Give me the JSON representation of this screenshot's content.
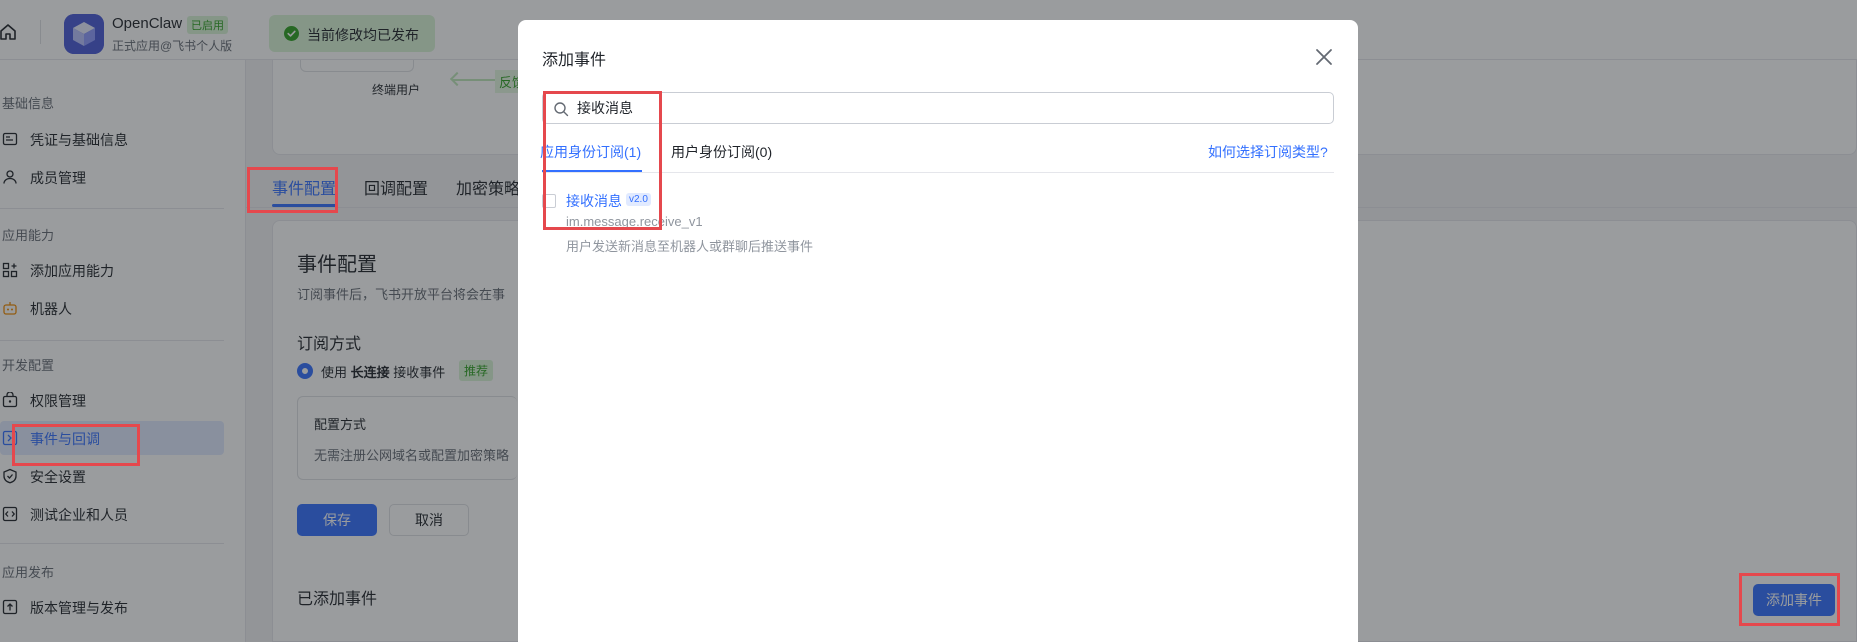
{
  "header": {
    "app_name": "OpenClaw",
    "enabled_badge": "已启用",
    "app_subtitle": "正式应用@飞书个人版",
    "publish_status": "当前修改均已发布"
  },
  "sidebar": {
    "sections": [
      {
        "label": "基础信息",
        "items": [
          {
            "label": "凭证与基础信息",
            "icon": "credential-icon"
          },
          {
            "label": "成员管理",
            "icon": "user-icon"
          }
        ]
      },
      {
        "label": "应用能力",
        "items": [
          {
            "label": "添加应用能力",
            "icon": "grid-plus-icon"
          },
          {
            "label": "机器人",
            "icon": "robot-icon"
          }
        ]
      },
      {
        "label": "开发配置",
        "items": [
          {
            "label": "权限管理",
            "icon": "lock-box-icon"
          },
          {
            "label": "事件与回调",
            "icon": "event-icon"
          },
          {
            "label": "安全设置",
            "icon": "shield-icon"
          },
          {
            "label": "测试企业和人员",
            "icon": "code-box-icon"
          }
        ]
      },
      {
        "label": "应用发布",
        "items": [
          {
            "label": "版本管理与发布",
            "icon": "upload-icon"
          }
        ]
      }
    ],
    "active_item": "事件与回调"
  },
  "flow": {
    "end_user": "终端用户",
    "feedback": "反馈"
  },
  "main_tabs": [
    {
      "label": "事件配置",
      "active": true
    },
    {
      "label": "回调配置",
      "active": false
    },
    {
      "label": "加密策略",
      "active": false
    }
  ],
  "event_config": {
    "title": "事件配置",
    "description": "订阅事件后，飞书开放平台将会在事",
    "subscription_title": "订阅方式",
    "radio_prefix": "使用",
    "radio_bold": "长连接",
    "radio_suffix": "接收事件",
    "recommended": "推荐",
    "method_title": "配置方式",
    "method_desc": "无需注册公网域名或配置加密策略",
    "save_label": "保存",
    "cancel_label": "取消",
    "added_events_title": "已添加事件",
    "add_event_label": "添加事件"
  },
  "modal": {
    "title": "添加事件",
    "search_value": "接收消息",
    "tabs": [
      {
        "label": "应用身份订阅(1)",
        "active": true
      },
      {
        "label": "用户身份订阅(0)",
        "active": false
      }
    ],
    "help_link": "如何选择订阅类型?",
    "events": [
      {
        "name": "接收消息",
        "version": "v2.0",
        "key": "im.message.receive_v1",
        "description": "用户发送新消息至机器人或群聊后推送事件",
        "checked": false
      }
    ]
  },
  "colors": {
    "primary": "#3370ff",
    "success": "#2ea121",
    "highlight": "#e5484d"
  }
}
